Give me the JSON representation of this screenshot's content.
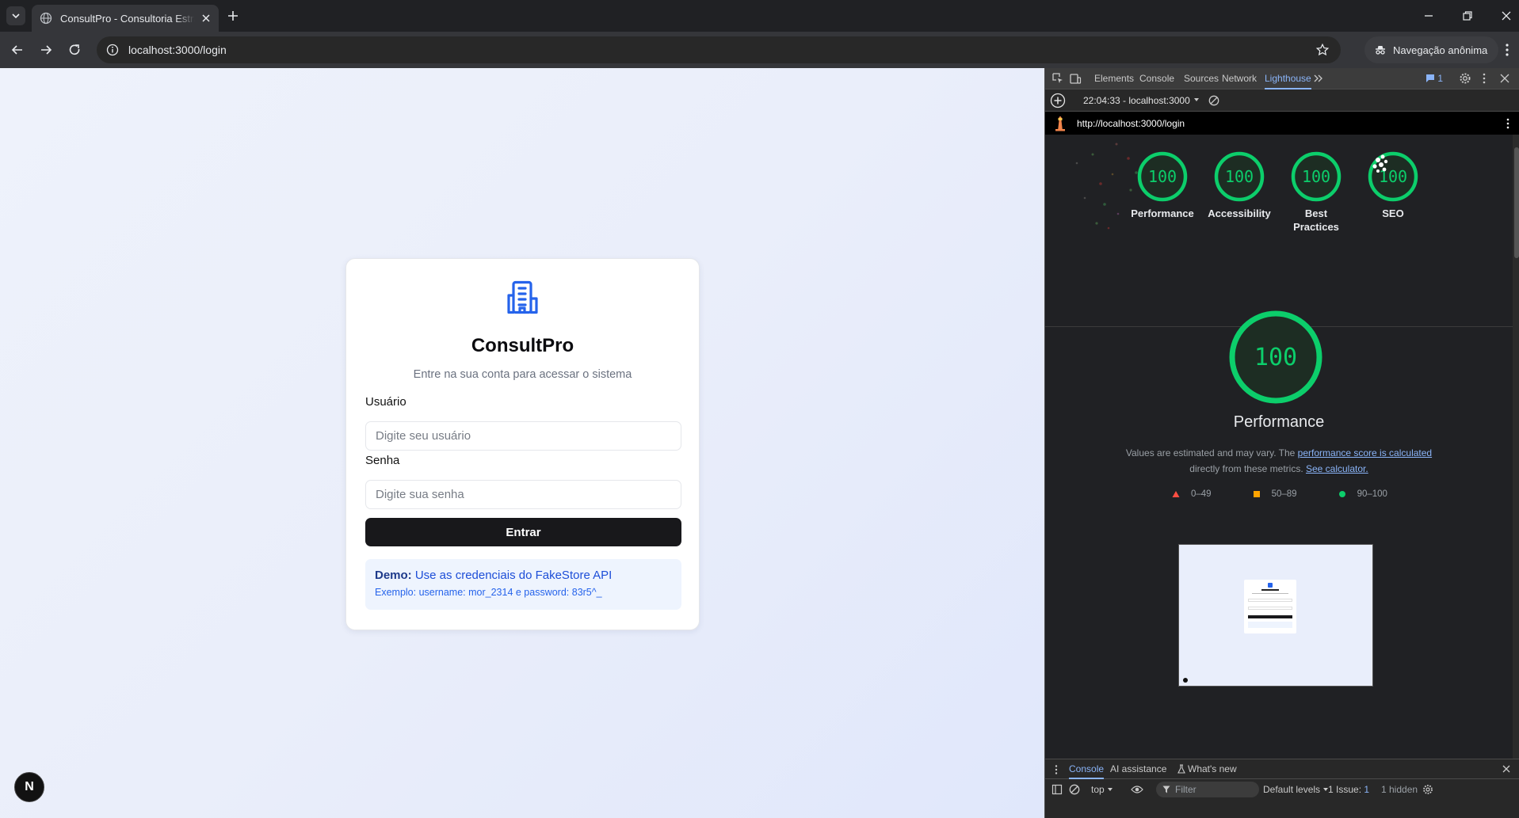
{
  "browser": {
    "tab_title": "ConsultPro - Consultoria Estratégica",
    "url": "localhost:3000/login",
    "incognito_label": "Navegação anônima"
  },
  "login": {
    "brand": "ConsultPro",
    "subtitle": "Entre na sua conta para acessar o sistema",
    "user_label": "Usuário",
    "user_placeholder": "Digite seu usuário",
    "password_label": "Senha",
    "password_placeholder": "Digite sua senha",
    "submit_label": "Entrar",
    "demo_title": "Demo:",
    "demo_text": "Use as credenciais do FakeStore API",
    "demo_example": "Exemplo: username: mor_2314 e password: 83r5^_"
  },
  "next_badge": "N",
  "devtools": {
    "tabs": [
      "Elements",
      "Console",
      "Sources",
      "Network",
      "Lighthouse"
    ],
    "active_tab": "Lighthouse",
    "issues_count": "1",
    "report_selector": "22:04:33 - localhost:3000",
    "report_url": "http://localhost:3000/login",
    "scores": [
      {
        "label": "Performance",
        "score": 100
      },
      {
        "label": "Accessibility",
        "score": 100
      },
      {
        "label": "Best Practices",
        "score": 100
      },
      {
        "label": "SEO",
        "score": 100
      }
    ],
    "main_score": 100,
    "main_label": "Performance",
    "desc_prefix": "Values are estimated and may vary. The ",
    "desc_link1": "performance score is calculated",
    "desc_middle": " directly from these metrics. ",
    "desc_link2": "See calculator.",
    "legend": [
      "0–49",
      "50–89",
      "90–100"
    ],
    "colors": {
      "fail": "#ff4e42",
      "average": "#ffa400",
      "pass": "#0cce6b"
    },
    "drawer_tabs": [
      "Console",
      "AI assistance",
      "What's new"
    ],
    "console_context": "top",
    "filter_placeholder": "Filter",
    "levels": "Default levels",
    "issues_text": "1 Issue:",
    "issues_badge": "1",
    "hidden_text": "1 hidden"
  }
}
